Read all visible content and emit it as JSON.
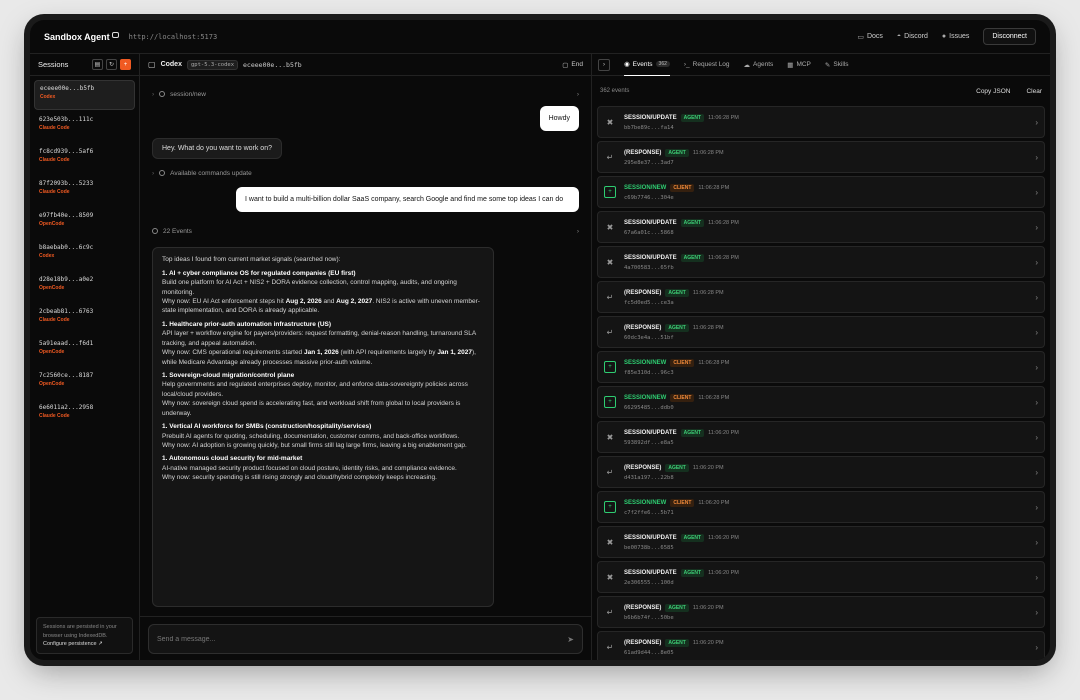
{
  "header": {
    "brand": "Sandbox Agent",
    "url": "http://localhost:5173",
    "links": [
      "Docs",
      "Discord",
      "Issues"
    ],
    "disconnect": "Disconnect"
  },
  "sidebar": {
    "title": "Sessions",
    "items": [
      {
        "id": "eceee00e...b5fb",
        "agent": "Codex"
      },
      {
        "id": "623e503b...111c",
        "agent": "Claude Code"
      },
      {
        "id": "fc8cd939...5af6",
        "agent": "Claude Code"
      },
      {
        "id": "87f2093b...5233",
        "agent": "Claude Code"
      },
      {
        "id": "e97fb40e...8509",
        "agent": "OpenCode"
      },
      {
        "id": "b8aebab0...6c9c",
        "agent": "Codex"
      },
      {
        "id": "d28e18b9...a0e2",
        "agent": "OpenCode"
      },
      {
        "id": "2cbeab81...6763",
        "agent": "Claude Code"
      },
      {
        "id": "5a91eaad...f6d1",
        "agent": "OpenCode"
      },
      {
        "id": "7c2560ce...8187",
        "agent": "OpenCode"
      },
      {
        "id": "6e6011a2...2958",
        "agent": "Claude Code"
      }
    ],
    "persist_text": "Sessions are persisted in your browser using IndexedDB.",
    "persist_link": "Configure persistence ↗"
  },
  "chat": {
    "title": "Codex",
    "model": "gpt-5.3-codex",
    "session": "eceee00e...b5fb",
    "end": "End",
    "sys_session_new": "session/new",
    "user_msg_1": "Howdy",
    "agent_msg_1": "Hey. What do you want to work on?",
    "sys_commands": "Available commands update",
    "user_msg_2": "I want to build a multi-billion dollar SaaS company, search Google and find me some top ideas I can do",
    "events_count": "22 Events",
    "answer": {
      "intro": "Top ideas I found from current market signals (searched now):",
      "ideas": [
        {
          "title": "1. AI + cyber compliance OS for regulated companies (EU first)",
          "body": "Build one platform for AI Act + NIS2 + DORA evidence collection, control mapping, audits, and ongoing monitoring.",
          "why": "Why now: EU AI Act enforcement steps hit Aug 2, 2026 and Aug 2, 2027. NIS2 is active with uneven member-state implementation, and DORA is already applicable."
        },
        {
          "title": "1. Healthcare prior-auth automation infrastructure (US)",
          "body": "API layer + workflow engine for payers/providers: request formatting, denial-reason handling, turnaround SLA tracking, and appeal automation.",
          "why": "Why now: CMS operational requirements started Jan 1, 2026 (with API requirements largely by Jan 1, 2027), while Medicare Advantage already processes massive prior-auth volume."
        },
        {
          "title": "1. Sovereign-cloud migration/control plane",
          "body": "Help governments and regulated enterprises deploy, monitor, and enforce data-sovereignty policies across local/cloud providers.",
          "why": "Why now: sovereign cloud spend is accelerating fast, and workload shift from global to local providers is underway."
        },
        {
          "title": "1. Vertical AI workforce for SMBs (construction/hospitality/services)",
          "body": "Prebuilt AI agents for quoting, scheduling, documentation, customer comms, and back-office workflows.",
          "why": "Why now: AI adoption is growing quickly, but small firms still lag large firms, leaving a big enablement gap."
        },
        {
          "title": "1. Autonomous cloud security for mid-market",
          "body": "AI-native managed security product focused on cloud posture, identity risks, and compliance evidence.",
          "why": "Why now: security spending is still rising strongly and cloud/hybrid complexity keeps increasing."
        }
      ]
    },
    "placeholder": "Send a message..."
  },
  "events": {
    "tabs": [
      {
        "label": "Events",
        "count": "362"
      },
      {
        "label": "Request Log"
      },
      {
        "label": "Agents"
      },
      {
        "label": "MCP"
      },
      {
        "label": "Skills"
      }
    ],
    "total": "362 events",
    "copy_json": "Copy JSON",
    "clear": "Clear",
    "items": [
      {
        "type": "SESSION/UPDATE",
        "src": "AGENT",
        "time": "11:06:28 PM",
        "id": "bb7be89c...fa14",
        "kind": "update"
      },
      {
        "type": "(RESPONSE)",
        "src": "AGENT",
        "time": "11:06:28 PM",
        "id": "295e8e37...3ad7",
        "kind": "response"
      },
      {
        "type": "SESSION/NEW",
        "src": "CLIENT",
        "time": "11:06:28 PM",
        "id": "c69b7746...304e",
        "kind": "new"
      },
      {
        "type": "SESSION/UPDATE",
        "src": "AGENT",
        "time": "11:06:28 PM",
        "id": "67a6a01c...5868",
        "kind": "update"
      },
      {
        "type": "SESSION/UPDATE",
        "src": "AGENT",
        "time": "11:06:28 PM",
        "id": "4a700583...65fb",
        "kind": "update"
      },
      {
        "type": "(RESPONSE)",
        "src": "AGENT",
        "time": "11:06:28 PM",
        "id": "fc5d0ed5...ce3a",
        "kind": "response"
      },
      {
        "type": "(RESPONSE)",
        "src": "AGENT",
        "time": "11:06:28 PM",
        "id": "60dc3e4a...51bf",
        "kind": "response"
      },
      {
        "type": "SESSION/NEW",
        "src": "CLIENT",
        "time": "11:06:28 PM",
        "id": "f85e310d...96c3",
        "kind": "new"
      },
      {
        "type": "SESSION/NEW",
        "src": "CLIENT",
        "time": "11:06:28 PM",
        "id": "66295485...ddb0",
        "kind": "new"
      },
      {
        "type": "SESSION/UPDATE",
        "src": "AGENT",
        "time": "11:06:20 PM",
        "id": "593892df...e8a5",
        "kind": "update"
      },
      {
        "type": "(RESPONSE)",
        "src": "AGENT",
        "time": "11:06:20 PM",
        "id": "d431a197...22b8",
        "kind": "response"
      },
      {
        "type": "SESSION/NEW",
        "src": "CLIENT",
        "time": "11:06:20 PM",
        "id": "c7f2ffe6...5b71",
        "kind": "new"
      },
      {
        "type": "SESSION/UPDATE",
        "src": "AGENT",
        "time": "11:06:20 PM",
        "id": "be00738b...6585",
        "kind": "update"
      },
      {
        "type": "SESSION/UPDATE",
        "src": "AGENT",
        "time": "11:06:20 PM",
        "id": "2e306555...100d",
        "kind": "update"
      },
      {
        "type": "(RESPONSE)",
        "src": "AGENT",
        "time": "11:06:20 PM",
        "id": "b6b6b74f...50be",
        "kind": "response"
      },
      {
        "type": "(RESPONSE)",
        "src": "AGENT",
        "time": "11:06:20 PM",
        "id": "61ad9d44...8e05",
        "kind": "response"
      }
    ]
  }
}
